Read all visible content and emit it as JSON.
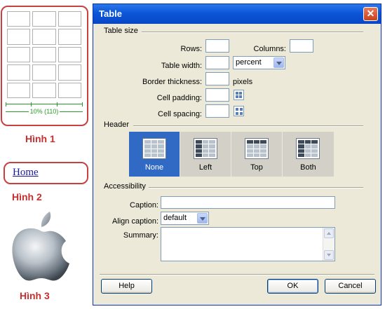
{
  "figures": {
    "fig1_measure": "10% (110)",
    "fig1_caption": "Hình 1",
    "fig2_link": "Home",
    "fig2_caption": "Hình 2",
    "fig3_caption": "Hình 3"
  },
  "dialog": {
    "title": "Table",
    "close_icon": "close-icon",
    "table_size": {
      "heading": "Table size",
      "rows_label": "Rows:",
      "rows_value": "",
      "columns_label": "Columns:",
      "columns_value": "",
      "width_label": "Table width:",
      "width_value": "",
      "width_unit": "percent",
      "border_label": "Border thickness:",
      "border_value": "",
      "border_unit": "pixels",
      "padding_label": "Cell padding:",
      "padding_value": "",
      "spacing_label": "Cell spacing:",
      "spacing_value": ""
    },
    "header": {
      "heading": "Header",
      "options": [
        "None",
        "Left",
        "Top",
        "Both"
      ],
      "selected": "None"
    },
    "accessibility": {
      "heading": "Accessibility",
      "caption_label": "Caption:",
      "caption_value": "",
      "align_label": "Align caption:",
      "align_value": "default",
      "summary_label": "Summary:",
      "summary_value": ""
    },
    "buttons": {
      "help": "Help",
      "ok": "OK",
      "cancel": "Cancel"
    }
  },
  "colors": {
    "titlebar": "#0b56d8",
    "dialog_bg": "#ece9d8",
    "selected_header": "#316ac5",
    "figure_border": "#c84040"
  }
}
